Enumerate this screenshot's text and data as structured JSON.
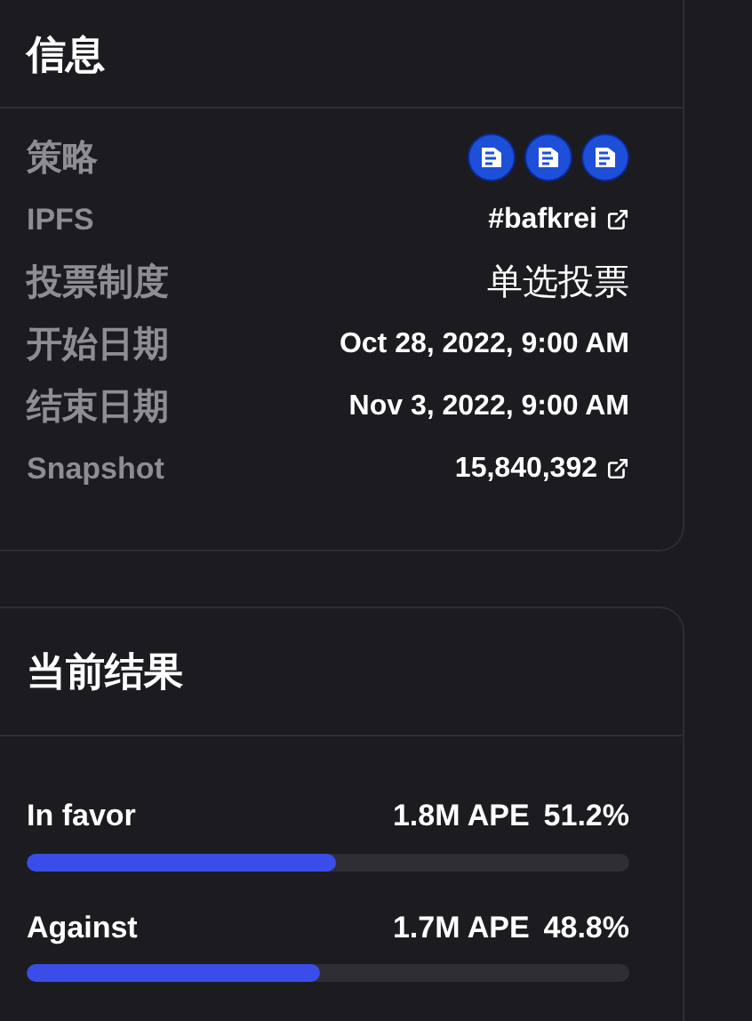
{
  "info": {
    "title": "信息",
    "rows": [
      {
        "kind": "icons",
        "label": "策略",
        "icons": [
          {
            "kind": "strategy"
          },
          {
            "kind": "strategy"
          },
          {
            "kind": "strategy"
          }
        ]
      },
      {
        "kind": "link",
        "label": "IPFS",
        "value": "#bafkrei"
      },
      {
        "kind": "text",
        "label": "投票制度",
        "value": "单选投票"
      },
      {
        "kind": "text",
        "label": "开始日期",
        "value": "Oct 28, 2022, 9:00 AM"
      },
      {
        "kind": "text",
        "label": "结束日期",
        "value": "Nov 3, 2022, 9:00 AM"
      },
      {
        "kind": "link",
        "label": "Snapshot",
        "value": "15,840,392"
      }
    ]
  },
  "results": {
    "title": "当前结果",
    "choices": [
      {
        "label": "In favor",
        "amount": "1.8M APE",
        "percent": "51.2%",
        "level": 0.512
      },
      {
        "label": "Against",
        "amount": "1.7M APE",
        "percent": "48.8%",
        "level": 0.488
      }
    ]
  }
}
